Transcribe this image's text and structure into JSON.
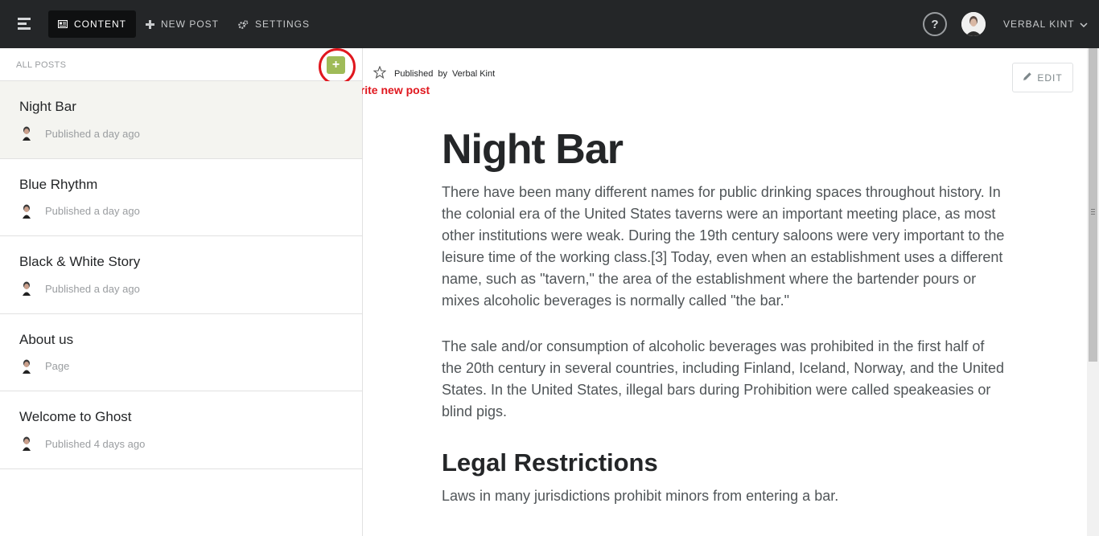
{
  "topbar": {
    "nav": [
      {
        "label": "CONTENT",
        "icon": "content-icon"
      },
      {
        "label": "NEW POST",
        "icon": "plus-icon"
      },
      {
        "label": "SETTINGS",
        "icon": "gears-icon"
      }
    ],
    "help_label": "?",
    "user_name": "VERBAL KINT"
  },
  "sidebar": {
    "header_label": "ALL POSTS",
    "new_post_symbol": "+",
    "annotation": "Click here to write new post",
    "posts": [
      {
        "title": "Night Bar",
        "meta": "Published a day ago",
        "selected": true
      },
      {
        "title": "Blue Rhythm",
        "meta": "Published a day ago"
      },
      {
        "title": "Black & White Story",
        "meta": "Published a day ago"
      },
      {
        "title": "About us",
        "meta": "Page"
      },
      {
        "title": "Welcome to Ghost",
        "meta": "Published 4 days ago"
      }
    ]
  },
  "preview": {
    "status": "Published",
    "by": "by",
    "author": "Verbal Kint",
    "edit_label": "EDIT",
    "title": "Night Bar",
    "paragraph1": "There have been many different names for public drinking spaces throughout history. In the colonial era of the United States taverns were an important meeting place, as most other institutions were weak. During the 19th century saloons were very impor­tant to the leisure time of the working class.[3] Today, even when an establishment uses a different name, such as \"tavern,\" the area of the establishment where the bar­tender pours or mixes alcoholic beverages is normally called \"the bar.\"",
    "paragraph2": "The sale and/or consumption of alcoholic beverages was prohibited in the first half of the 20th century in several countries, including Finland, Iceland, Norway, and the United States. In the United States, illegal bars during Prohibition were called speakeasies or blind pigs.",
    "heading2": "Legal Restrictions",
    "paragraph3": "Laws in many jurisdictions prohibit minors from entering a bar."
  },
  "colors": {
    "topbar": "#242628",
    "accent_green": "#9fbb58",
    "annotation_red": "#e0171e",
    "selected_row": "#f4f4f0"
  }
}
